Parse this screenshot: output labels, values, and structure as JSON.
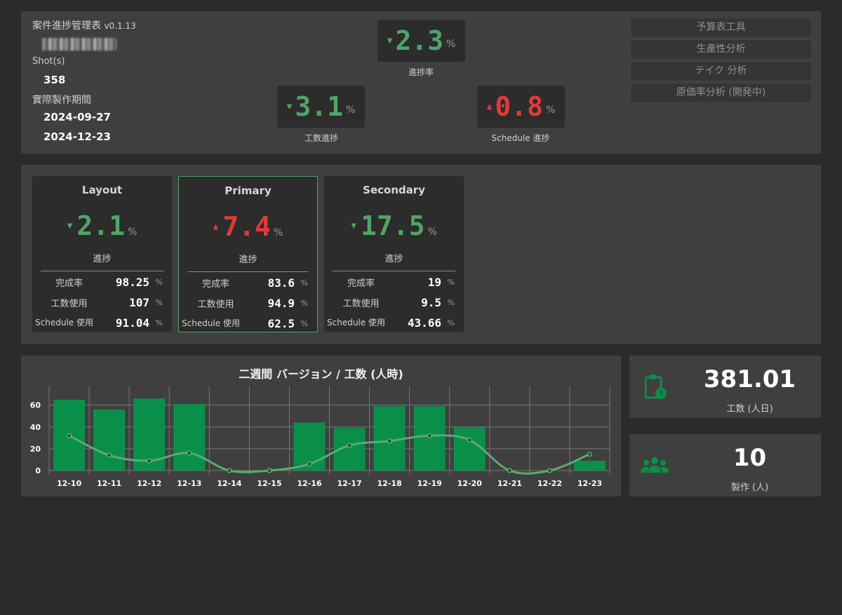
{
  "header": {
    "app_title": "案件進捗管理表",
    "version": "v0.1.13",
    "shot_label": "Shot(s)",
    "shot_value": "358",
    "period_label": "實際製作期間",
    "period_start": "2024-09-27",
    "period_end": "2024-12-23"
  },
  "kpis": {
    "progress": {
      "value": "2.3",
      "unit": "%",
      "caption": "進捗率",
      "trend": "down",
      "color": "#4fa467"
    },
    "effort": {
      "value": "3.1",
      "unit": "%",
      "caption": "工数進捗",
      "trend": "down",
      "color": "#4fa467"
    },
    "schedule": {
      "value": "0.8",
      "unit": "%",
      "caption": "Schedule 進捗",
      "trend": "up",
      "color": "#e03a3a"
    }
  },
  "side_menu": {
    "budget": "予算表工具",
    "productivity": "生產性分析",
    "take": "テイク 分析",
    "cost": "原価率分析 (開発中)"
  },
  "cards": [
    {
      "name": "Layout",
      "value": "2.1",
      "unit": "%",
      "trend": "down",
      "progress_label": "進捗",
      "rows": [
        {
          "label": "完成率",
          "value": "98.25",
          "unit": "%",
          "color": "#ffffff"
        },
        {
          "label": "工数使用",
          "value": "107",
          "unit": "%",
          "color": "#e03a3a"
        },
        {
          "label": "Schedule 使用",
          "value": "91.04",
          "unit": "%",
          "color": "#f3cf1a"
        }
      ]
    },
    {
      "name": "Primary",
      "value": "7.4",
      "unit": "%",
      "trend": "up",
      "progress_label": "進捗",
      "rows": [
        {
          "label": "完成率",
          "value": "83.6",
          "unit": "%",
          "color": "#ffffff"
        },
        {
          "label": "工数使用",
          "value": "94.9",
          "unit": "%",
          "color": "#f3cf1a"
        },
        {
          "label": "Schedule 使用",
          "value": "62.5",
          "unit": "%",
          "color": "#ffffff"
        }
      ]
    },
    {
      "name": "Secondary",
      "value": "17.5",
      "unit": "%",
      "trend": "down",
      "progress_label": "進捗",
      "rows": [
        {
          "label": "完成率",
          "value": "19",
          "unit": "%",
          "color": "#ffffff"
        },
        {
          "label": "工数使用",
          "value": "9.5",
          "unit": "%",
          "color": "#ffffff"
        },
        {
          "label": "Schedule 使用",
          "value": "43.66",
          "unit": "%",
          "color": "#ffffff"
        }
      ]
    }
  ],
  "stats": {
    "effort_value": "381.01",
    "effort_caption": "工数 (人日)",
    "staff_value": "10",
    "staff_caption": "製作 (人)"
  },
  "chart_data": {
    "type": "bar",
    "title": "二週間 バージョン / 工数 (人時)",
    "categories": [
      "12-10",
      "12-11",
      "12-12",
      "12-13",
      "12-14",
      "12-15",
      "12-16",
      "12-17",
      "12-18",
      "12-19",
      "12-20",
      "12-21",
      "12-22",
      "12-23"
    ],
    "series": [
      {
        "type": "bar",
        "values": [
          65,
          56,
          66,
          61,
          0,
          0,
          44,
          39,
          59,
          59,
          40,
          0,
          0,
          9
        ],
        "color": "#0a8f4a"
      },
      {
        "type": "line",
        "values": [
          32,
          14,
          9,
          16,
          0,
          0,
          6,
          23,
          27,
          32,
          28,
          0,
          0,
          15
        ],
        "color": "#5aac6e"
      }
    ],
    "yticks": [
      0,
      20,
      40,
      60
    ],
    "ylim": [
      0,
      72
    ],
    "grid": true
  }
}
